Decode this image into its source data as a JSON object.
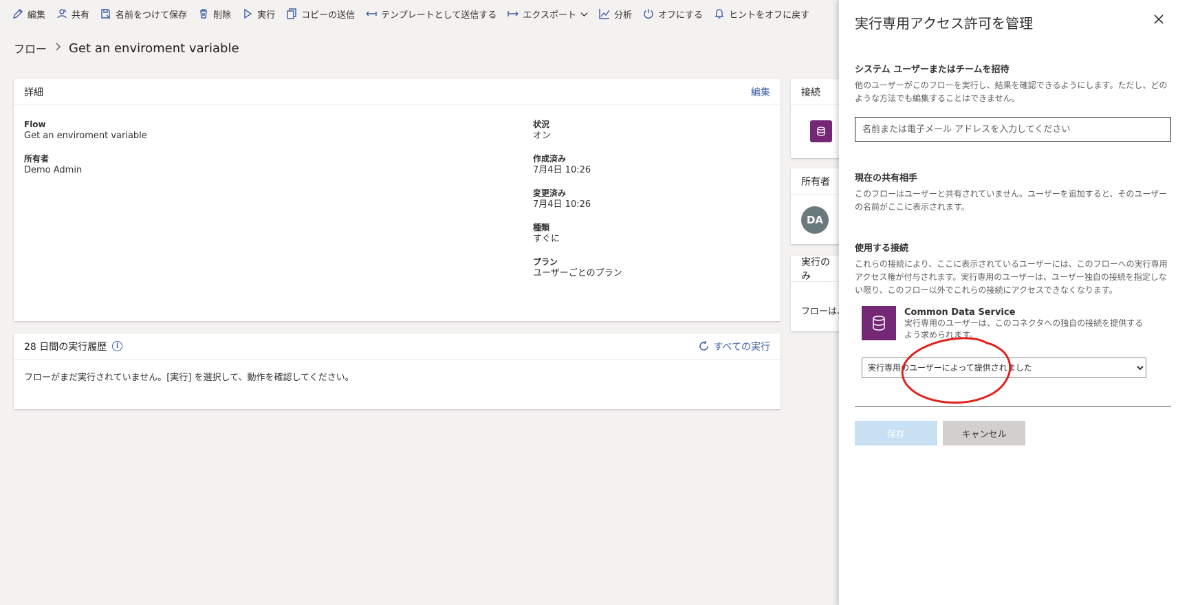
{
  "toolbar": {
    "items": [
      {
        "label": "編集",
        "icon": "edit-icon"
      },
      {
        "label": "共有",
        "icon": "share-icon"
      },
      {
        "label": "名前をつけて保存",
        "icon": "save-as-icon"
      },
      {
        "label": "削除",
        "icon": "delete-icon"
      },
      {
        "label": "実行",
        "icon": "play-icon"
      },
      {
        "label": "コピーの送信",
        "icon": "copy-icon"
      },
      {
        "label": "テンプレートとして送信する",
        "icon": "template-icon"
      },
      {
        "label": "エクスポート",
        "icon": "export-icon"
      },
      {
        "label": "分析",
        "icon": "analytics-icon"
      },
      {
        "label": "オフにする",
        "icon": "power-icon"
      },
      {
        "label": "ヒントをオフに戻す",
        "icon": "bell-icon"
      }
    ]
  },
  "breadcrumb": {
    "root": "フロー",
    "current": "Get an enviroment variable"
  },
  "details": {
    "title": "詳細",
    "edit_link": "編集",
    "flow_label": "Flow",
    "flow_value": "Get an enviroment variable",
    "owner_label": "所有者",
    "owner_value": "Demo Admin",
    "status_label": "状況",
    "status_value": "オン",
    "created_label": "作成済み",
    "created_value": "7月4日 10:26",
    "modified_label": "変更済み",
    "modified_value": "7月4日 10:26",
    "type_label": "種類",
    "type_value": "すぐに",
    "plan_label": "プラン",
    "plan_value": "ユーザーごとのプラン"
  },
  "history": {
    "title": "28 日間の実行履歴",
    "all_runs_link": "すべての実行",
    "empty_text": "フローがまだ実行されていません。[実行] を選択して、動作を確認してください。"
  },
  "side": {
    "connections_title": "接続",
    "owners_title": "所有者",
    "avatar_initials": "DA",
    "runonly_title": "実行のみ",
    "runonly_text": "フローは、"
  },
  "panel": {
    "title": "実行専用アクセス許可を管理",
    "invite_heading": "システム ユーザーまたはチームを招待",
    "invite_desc": "他のユーザーがこのフローを実行し、結果を確認できるようにします。ただし、どのような方法でも編集することはできません。",
    "invite_placeholder": "名前または電子メール アドレスを入力してください",
    "shared_heading": "現在の共有相手",
    "shared_desc": "このフローはユーザーと共有されていません。ユーザーを追加すると、そのユーザーの名前がここに表示されます。",
    "connections_heading": "使用する接続",
    "connections_desc": "これらの接続により、ここに表示されているユーザーには、このフローへの実行専用アクセス権が付与されます。実行専用のユーザーは、ユーザー独自の接続を指定しない限り、このフロー以外でこれらの接続にアクセスできなくなります。",
    "connector_name": "Common Data Service",
    "connector_desc": "実行専用のユーザーは、このコネクタへの独自の接続を提供するよう求められます。",
    "connector_select_value": "実行専用のユーザーによって提供されました",
    "save_label": "保存",
    "cancel_label": "キャンセル"
  },
  "colors": {
    "accent": "#3b5da7",
    "cds_purple": "#742774",
    "annotation_red": "#e0201b",
    "save_disabled": "#c7e0f4"
  }
}
